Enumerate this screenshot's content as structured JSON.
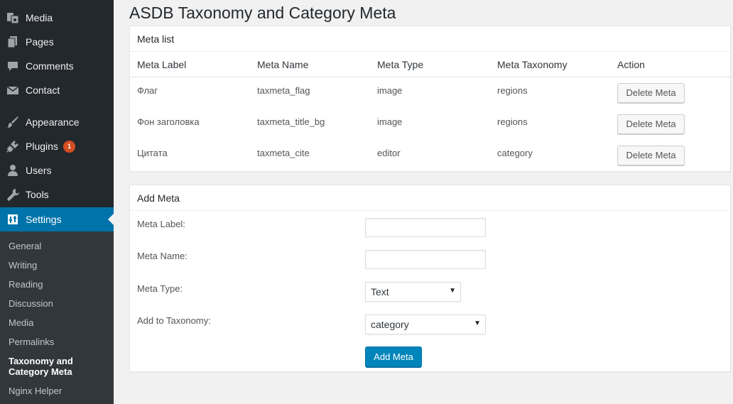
{
  "sidebar": {
    "items": [
      {
        "label": "Media",
        "icon": "media-icon"
      },
      {
        "label": "Pages",
        "icon": "pages-icon"
      },
      {
        "label": "Comments",
        "icon": "comments-icon"
      },
      {
        "label": "Contact",
        "icon": "mail-icon"
      },
      {
        "label": "Appearance",
        "icon": "brush-icon"
      },
      {
        "label": "Plugins",
        "icon": "plugin-icon",
        "badge": "1"
      },
      {
        "label": "Users",
        "icon": "users-icon"
      },
      {
        "label": "Tools",
        "icon": "wrench-icon"
      },
      {
        "label": "Settings",
        "icon": "settings-icon",
        "current": true
      }
    ],
    "submenu": [
      {
        "label": "General"
      },
      {
        "label": "Writing"
      },
      {
        "label": "Reading"
      },
      {
        "label": "Discussion"
      },
      {
        "label": "Media"
      },
      {
        "label": "Permalinks"
      },
      {
        "label": "Taxonomy and Category Meta",
        "current": true
      },
      {
        "label": "Nginx Helper"
      }
    ]
  },
  "page": {
    "title": "ASDB Taxonomy and Category Meta"
  },
  "meta_list": {
    "title": "Meta list",
    "columns": [
      "Meta Label",
      "Meta Name",
      "Meta Type",
      "Meta Taxonomy",
      "Action"
    ],
    "rows": [
      {
        "label": "Флаг",
        "name": "taxmeta_flag",
        "type": "image",
        "taxonomy": "regions",
        "action": "Delete Meta"
      },
      {
        "label": "Фон заголовка",
        "name": "taxmeta_title_bg",
        "type": "image",
        "taxonomy": "regions",
        "action": "Delete Meta"
      },
      {
        "label": "Цитата",
        "name": "taxmeta_cite",
        "type": "editor",
        "taxonomy": "category",
        "action": "Delete Meta"
      }
    ]
  },
  "add_meta": {
    "title": "Add Meta",
    "meta_label": {
      "label": "Meta Label:",
      "value": ""
    },
    "meta_name": {
      "label": "Meta Name:",
      "value": ""
    },
    "meta_type": {
      "label": "Meta Type:",
      "selected": "Text"
    },
    "taxonomy": {
      "label": "Add to Taxonomy:",
      "selected": "category"
    },
    "submit_label": "Add Meta"
  },
  "colors": {
    "sidebar_bg": "#23282d",
    "submenu_bg": "#32373c",
    "accent": "#0073aa",
    "primary_button": "#0085ba",
    "badge": "#d54e21"
  }
}
